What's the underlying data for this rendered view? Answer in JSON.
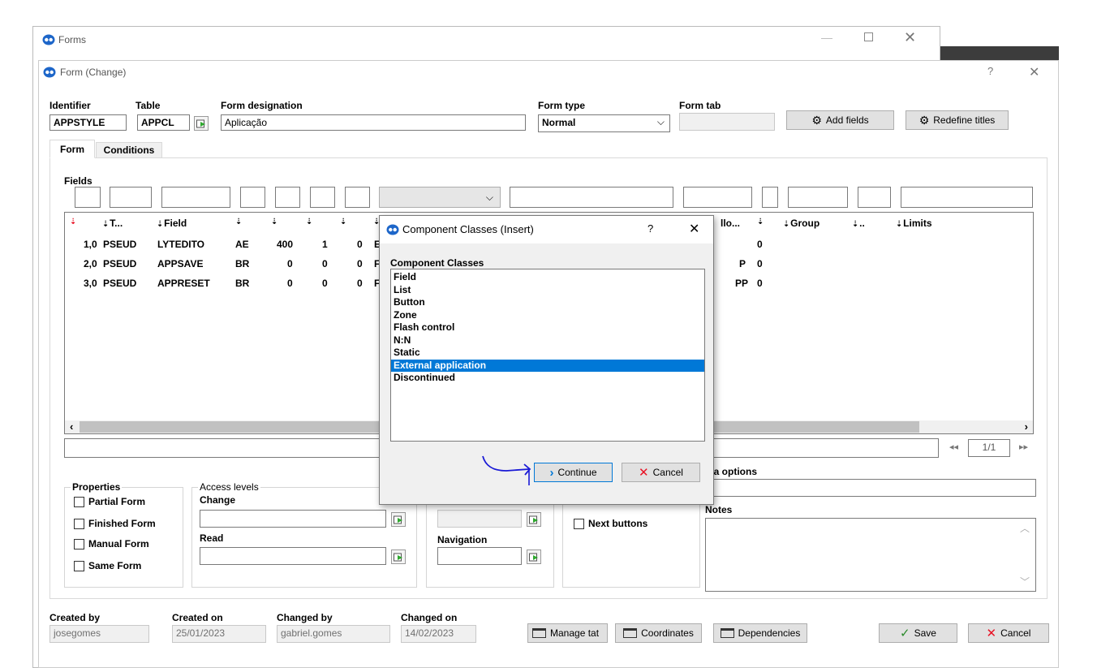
{
  "outer_window": {
    "title": "Forms"
  },
  "window": {
    "title": "Form (Change)",
    "help": "?"
  },
  "header": {
    "identifier": {
      "label": "Identifier",
      "value": "APPSTYLE"
    },
    "table": {
      "label": "Table",
      "value": "APPCL"
    },
    "designation": {
      "label": "Form designation",
      "value": "Aplicação"
    },
    "form_type": {
      "label": "Form type",
      "value": "Normal"
    },
    "form_tab": {
      "label": "Form tab",
      "value": ""
    },
    "add_fields": "Add fields",
    "redefine_titles": "Redefine titles"
  },
  "tabs": [
    "Form",
    "Conditions"
  ],
  "fields": {
    "label": "Fields",
    "columns": [
      "T...",
      "Field",
      "Group",
      "..",
      "Limits",
      "llo..."
    ],
    "rows": [
      {
        "order": "1,0",
        "type": "PSEUD",
        "field": "LYTEDITO",
        "c1": "AE",
        "c2": "400",
        "c3": "1",
        "c4": "0",
        "c5": "E",
        "c6": "",
        "c7": "0"
      },
      {
        "order": "2,0",
        "type": "PSEUD",
        "field": "APPSAVE",
        "c1": "BR",
        "c2": "0",
        "c3": "0",
        "c4": "0",
        "c5": "F",
        "c6": "P",
        "c7": "0"
      },
      {
        "order": "3,0",
        "type": "PSEUD",
        "field": "APPRESET",
        "c1": "BR",
        "c2": "0",
        "c3": "0",
        "c4": "0",
        "c5": "F",
        "c6": "PP",
        "c7": "0"
      }
    ],
    "pager": "1/1"
  },
  "properties": {
    "title": "Properties",
    "items": [
      "Partial Form",
      "Finished Form",
      "Manual Form",
      "Same Form"
    ]
  },
  "access_levels": {
    "title": "Access levels",
    "change": "Change",
    "read": "Read"
  },
  "navigation": {
    "label": "Navigation"
  },
  "options": {
    "next_buttons": "Next buttons",
    "extra_options": "tra options",
    "notes": "Notes"
  },
  "footer": {
    "created_by": {
      "label": "Created by",
      "value": "josegomes"
    },
    "created_on": {
      "label": "Created on",
      "value": "25/01/2023"
    },
    "changed_by": {
      "label": "Changed by",
      "value": "gabriel.gomes"
    },
    "changed_on": {
      "label": "Changed on",
      "value": "14/02/2023"
    },
    "manage_tab": "Manage tat",
    "coordinates": "Coordinates",
    "dependencies": "Dependencies",
    "save": "Save",
    "cancel": "Cancel"
  },
  "dialog": {
    "title": "Component Classes (Insert)",
    "help": "?",
    "list_label": "Component Classes",
    "items": [
      "Field",
      "List",
      "Button",
      "Zone",
      "Flash control",
      "N:N",
      "Static",
      "External application",
      "Discontinued"
    ],
    "selected": "External application",
    "continue": "Continue",
    "cancel": "Cancel"
  },
  "colors": {
    "selection": "#0078d7",
    "annotation": "#1a1ad6",
    "cancel_red": "#e81123"
  }
}
